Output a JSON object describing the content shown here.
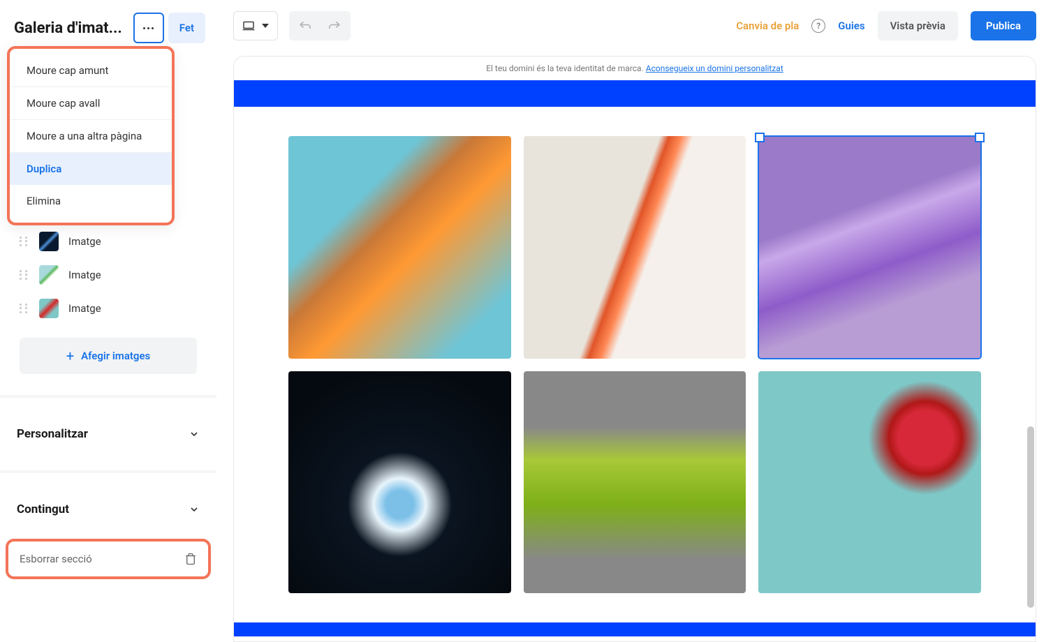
{
  "sidebar": {
    "title": "Galeria d'imat...",
    "done_label": "Fet"
  },
  "dropdown": {
    "items": [
      {
        "label": "Moure cap amunt",
        "highlighted": false
      },
      {
        "label": "Moure cap avall",
        "highlighted": false
      },
      {
        "label": "Moure a una altra pàgina",
        "highlighted": false
      },
      {
        "label": "Duplica",
        "highlighted": true
      },
      {
        "label": "Elimina",
        "highlighted": false
      }
    ]
  },
  "images_panel": {
    "items": [
      {
        "label": "Imatge"
      },
      {
        "label": "Imatge"
      },
      {
        "label": "Imatge"
      }
    ],
    "add_label": "Afegir imatges"
  },
  "sections": {
    "customize_label": "Personalitzar",
    "content_label": "Contingut",
    "delete_label": "Esborrar secció"
  },
  "topbar": {
    "plan_label": "Canvia de pla",
    "guides_label": "Guies",
    "preview_label": "Vista prèvia",
    "publish_label": "Publica"
  },
  "banner": {
    "text": "El teu domini és la teva identitat de marca. ",
    "link": "Aconsegueix un domini personalitzat"
  },
  "gallery": {
    "selected_index": 2
  }
}
